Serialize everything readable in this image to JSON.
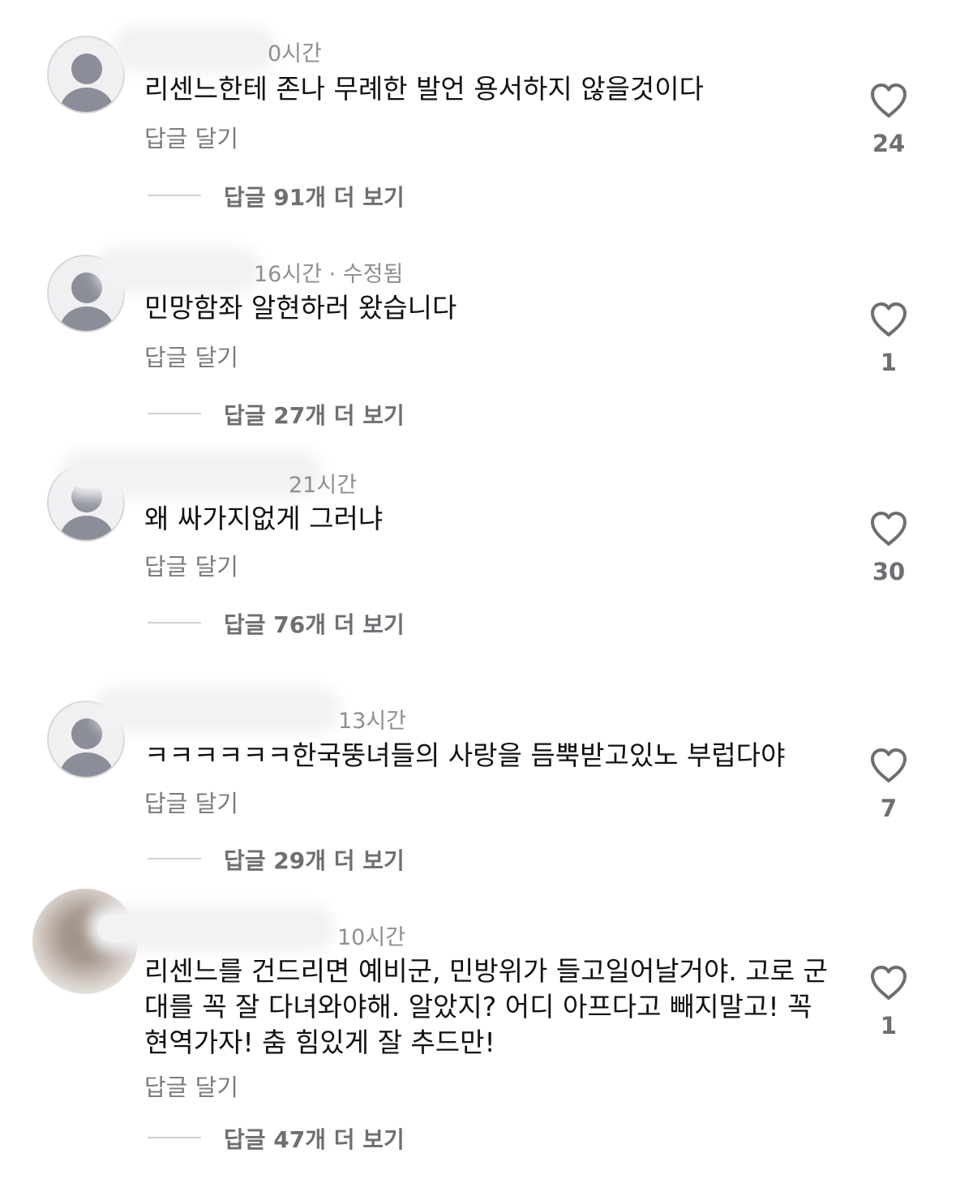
{
  "comments": [
    {
      "meta": "0시간",
      "text": "리센느한테 존나 무례한 발언 용서하지 않을것이다",
      "reply_label": "답글 달기",
      "view_replies": "답글 91개 더 보기",
      "likes": "24"
    },
    {
      "meta": "16시간 · 수정됨",
      "text": "민망함좌  알현하러 왔습니다",
      "reply_label": "답글 달기",
      "view_replies": "답글 27개 더 보기",
      "likes": "1"
    },
    {
      "meta": "21시간",
      "text": "왜 싸가지없게 그러냐",
      "reply_label": "답글 달기",
      "view_replies": "답글 76개 더 보기",
      "likes": "30"
    },
    {
      "meta": "13시간",
      "text": "ㅋㅋㅋㅋㅋㅋ한국뚱녀들의 사랑을 듬뿍받고있노 부럽다야",
      "reply_label": "답글 달기",
      "view_replies": "답글 29개 더 보기",
      "likes": "7"
    },
    {
      "meta": "10시간",
      "text": "리센느를 건드리면 예비군, 민방위가 들고일어날거야. 고로 군대를 꼭 잘 다녀와야해. 알았지? 어디 아프다고 빼지말고! 꼭 현역가자! 춤 힘있게 잘 추드만!",
      "reply_label": "답글 달기",
      "view_replies": "답글 47개 더 보기",
      "likes": "1"
    }
  ],
  "icons": {
    "avatar": "default-user-avatar-icon",
    "like": "heart-outline-icon"
  },
  "colors": {
    "text": "#111111",
    "meta": "#8e8e93",
    "secondary": "#6e6e73",
    "avatar_fg": "#8b8d98"
  }
}
